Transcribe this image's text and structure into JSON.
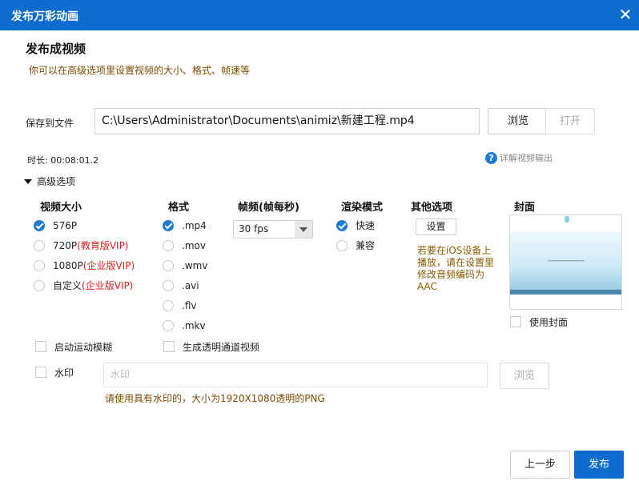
{
  "window": {
    "title": "发布万彩动画",
    "close_glyph": "✕"
  },
  "header": {
    "title": "发布成视频",
    "subtitle": "你可以在高级选项里设置视频的大小、格式、帧速等"
  },
  "save": {
    "label": "保存到文件",
    "path": "C:\\Users\\Administrator\\Documents\\animiz\\新建工程.mp4",
    "browse_label": "浏览",
    "open_label": "打开"
  },
  "duration": {
    "label": "时长:",
    "value": "00:08:01.2"
  },
  "help": {
    "icon_glyph": "?",
    "label": "详解视频输出"
  },
  "advanced": {
    "label": "高级选项"
  },
  "video_size": {
    "header": "视频大小",
    "options": [
      {
        "label": "576P",
        "suffix": "",
        "checked": true
      },
      {
        "label": "720P",
        "suffix": "(教育版VIP)",
        "checked": false
      },
      {
        "label": "1080P",
        "suffix": "(企业版VIP)",
        "checked": false
      },
      {
        "label": "自定义",
        "suffix": "(企业版VIP)",
        "checked": false
      }
    ]
  },
  "format": {
    "header": "格式",
    "options": [
      {
        "label": ".mp4",
        "checked": true
      },
      {
        "label": ".mov",
        "checked": false
      },
      {
        "label": ".wmv",
        "checked": false
      },
      {
        "label": ".avi",
        "checked": false
      },
      {
        "label": ".flv",
        "checked": false
      },
      {
        "label": ".mkv",
        "checked": false
      }
    ]
  },
  "framerate": {
    "header": "帧频(帧每秒)",
    "value": "30 fps"
  },
  "render_mode": {
    "header": "渲染模式",
    "options": [
      {
        "label": "快速",
        "checked": true
      },
      {
        "label": "兼容",
        "checked": false
      }
    ]
  },
  "other": {
    "header": "其他选项",
    "settings_label": "设置",
    "note_lines": [
      "若要在iOS设备上",
      "播放，请在设置里",
      "修改音频编码为",
      "AAC"
    ]
  },
  "cover": {
    "header": "封面",
    "use_label": "使用封面",
    "use_checked": false
  },
  "motion_blur": {
    "label": "启动运动模糊",
    "checked": false
  },
  "alpha_video": {
    "label": "生成透明通道视频",
    "checked": false
  },
  "watermark": {
    "label": "水印",
    "checked": false,
    "placeholder": "水印",
    "browse_label": "浏览",
    "hint": "请使用具有水印的，大小为1920X1080透明的PNG"
  },
  "footer": {
    "prev_label": "上一步",
    "publish_label": "发布"
  },
  "colors": {
    "accent": "#0d6ccd",
    "vip": "#e02020",
    "note": "#8a5a00"
  }
}
